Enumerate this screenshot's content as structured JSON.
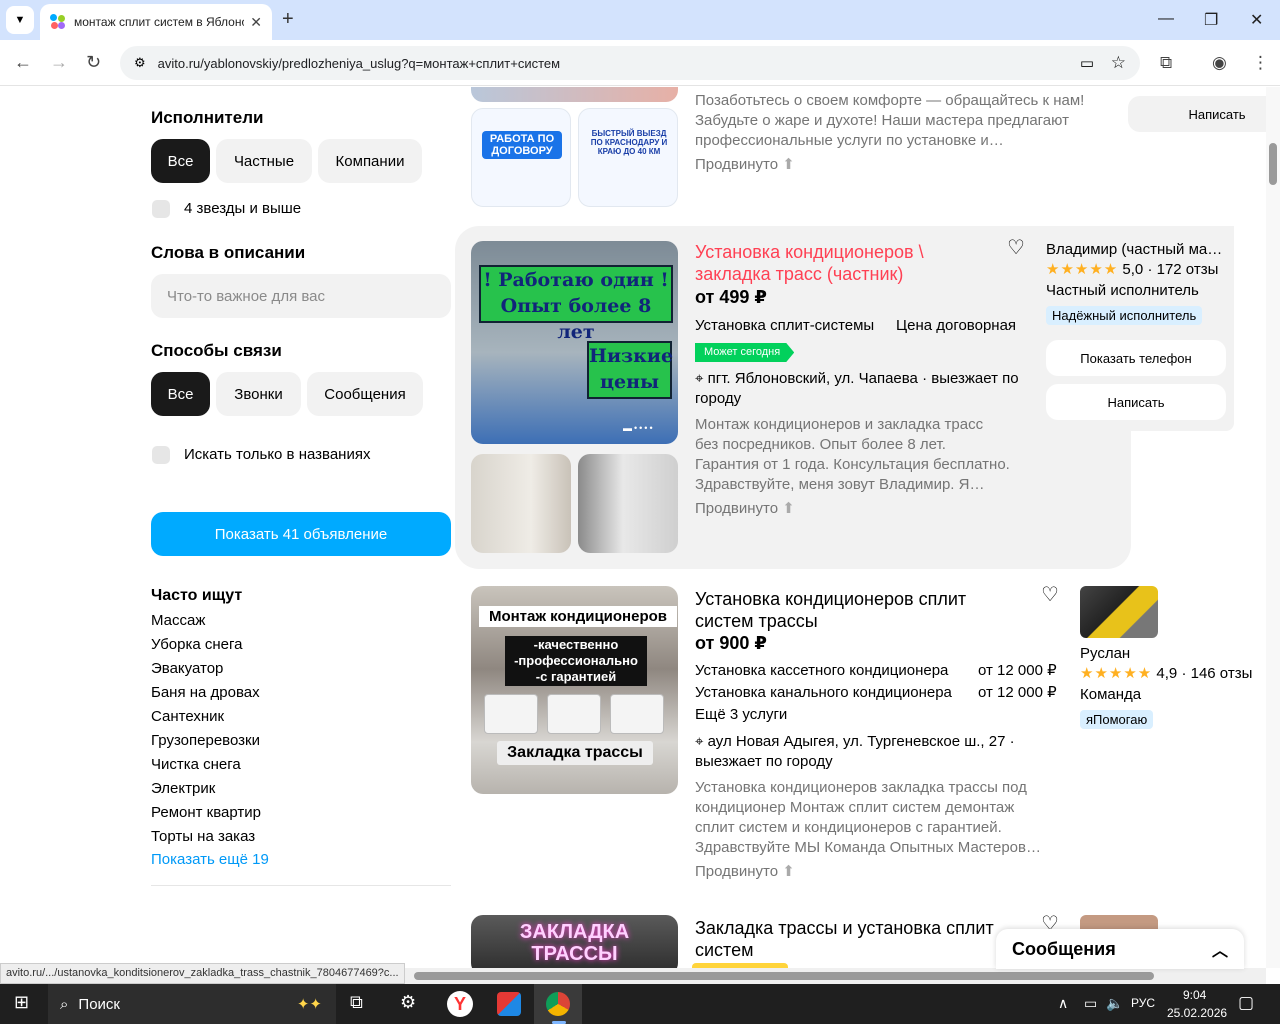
{
  "browser": {
    "tab_title": "монтаж сплит систем в Яблоновском",
    "url": "avito.ru/yablonovskiy/predlozheniya_uslug?q=монтаж+сплит+систем",
    "new_tab": "+",
    "minimize": "—",
    "restore": "❐",
    "close": "✕"
  },
  "filters": {
    "performers": {
      "title": "Исполнители",
      "options": [
        "Все",
        "Частные",
        "Компании"
      ]
    },
    "stars_check": "4 звезды и выше",
    "words": {
      "title": "Слова в описании",
      "placeholder": "Что-то важное для вас"
    },
    "contact": {
      "title": "Способы связи",
      "options": [
        "Все",
        "Звонки",
        "Сообщения"
      ]
    },
    "titles_check": "Искать только в названиях",
    "show_button": "Показать 41 объявление"
  },
  "popular": {
    "title": "Часто ищут",
    "items": [
      "Массаж",
      "Уборка снега",
      "Эвакуатор",
      "Баня на дровах",
      "Сантехник",
      "Грузоперевозки",
      "Чистка снега",
      "Электрик",
      "Ремонт квартир",
      "Торты на заказ"
    ],
    "more": "Показать ещё 19"
  },
  "card0": {
    "desc": [
      "Позаботьтесь о своем комфорте — обращайтесь к нам!",
      "Забудьте о жаре и духоте! Наши мастера предлагают",
      "профессиональные услуги по установке и…"
    ],
    "promoted": "Продвинуто",
    "write": "Написать",
    "img1": "РАБОТА ПО ДОГОВОРУ",
    "img2": "БЫСТРЫЙ ВЫЕЗД ПО КРАСНОДАРУ И КРАЮ ДО 40 КМ"
  },
  "card1": {
    "title": "Установка кондиционеров \\ закладка трасс (частник)",
    "price": "от 499 ₽",
    "service": "Установка сплит-системы",
    "service_price": "Цена договорная",
    "today": "Может сегодня",
    "address": "пгт. Яблоновский, ул. Чапаева · выезжает по городу",
    "desc": [
      "Монтаж кондиционеров и закладка трасс",
      "без посредников. Опыт более 8 лет.",
      "Гарантия от 1 года. Консультация бесплатно.",
      "Здравствуйте, меня зовут Владимир. Я…"
    ],
    "promoted": "Продвинуто",
    "seller": "Владимир (частный ма…",
    "rating": "5,0",
    "reviews": "· 172 отзы",
    "seller_type": "Частный исполнитель",
    "badge": "Надёжный исполнитель",
    "phone": "Показать телефон",
    "write": "Написать",
    "img_line1": "! Работаю один !",
    "img_line2": "Опыт более 8 лет",
    "img_line3": "Низкие",
    "img_line4": "цены"
  },
  "card2": {
    "title": "Установка кондиционеров сплит систем трассы",
    "price": "от 900 ₽",
    "services": [
      {
        "name": "Установка кассетного кондиционера",
        "price": "от 12 000 ₽"
      },
      {
        "name": "Установка канального кондиционера",
        "price": "от 12 000 ₽"
      }
    ],
    "more_services": "Ещё 3 услуги",
    "address": "аул Новая Адыгея, ул. Тургеневское ш., 27 · выезжает по городу",
    "desc": [
      "Установка кондиционеров закладка трассы под",
      "кондиционер Монтаж сплит систем демонтаж",
      "сплит систем и кондиционеров с гарантией.",
      "Здравствуйте МЫ Команда Опытных Мастеров…"
    ],
    "promoted": "Продвинуто",
    "seller": "Руслан",
    "rating": "4,9",
    "reviews": "· 146 отзы",
    "seller_type": "Команда",
    "badge": "яПомогаю",
    "img_top": "Монтаж кондиционеров",
    "img_mid1": "-качественно",
    "img_mid2": "-профессионально",
    "img_mid3": "-с гарантией",
    "img_bottom": "Закладка трассы"
  },
  "card3": {
    "title": "Закладка трассы и установка сплит систем",
    "img_text1": "ЗАКЛАДКА",
    "img_text2": "ТРАССЫ"
  },
  "status_url": "avito.ru/.../ustanovka_konditsionerov_zakladka_trass_chastnik_7804677469?c...",
  "messages": "Сообщения",
  "taskbar": {
    "search": "Поиск",
    "lang": "РУС",
    "time": "9:04",
    "date": "25.02.2026"
  }
}
